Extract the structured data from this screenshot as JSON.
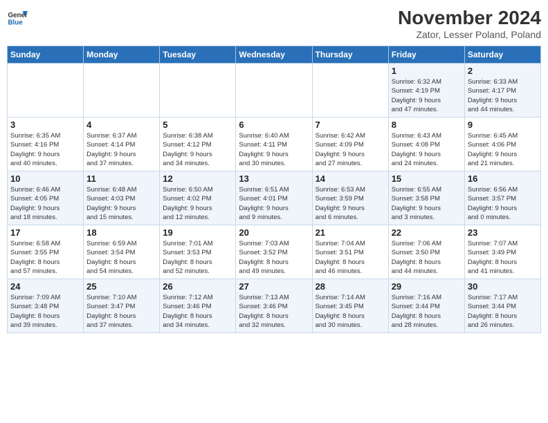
{
  "logo": {
    "line1": "General",
    "line2": "Blue"
  },
  "title": "November 2024",
  "location": "Zator, Lesser Poland, Poland",
  "headers": [
    "Sunday",
    "Monday",
    "Tuesday",
    "Wednesday",
    "Thursday",
    "Friday",
    "Saturday"
  ],
  "weeks": [
    [
      {
        "day": "",
        "info": ""
      },
      {
        "day": "",
        "info": ""
      },
      {
        "day": "",
        "info": ""
      },
      {
        "day": "",
        "info": ""
      },
      {
        "day": "",
        "info": ""
      },
      {
        "day": "1",
        "info": "Sunrise: 6:32 AM\nSunset: 4:19 PM\nDaylight: 9 hours\nand 47 minutes."
      },
      {
        "day": "2",
        "info": "Sunrise: 6:33 AM\nSunset: 4:17 PM\nDaylight: 9 hours\nand 44 minutes."
      }
    ],
    [
      {
        "day": "3",
        "info": "Sunrise: 6:35 AM\nSunset: 4:16 PM\nDaylight: 9 hours\nand 40 minutes."
      },
      {
        "day": "4",
        "info": "Sunrise: 6:37 AM\nSunset: 4:14 PM\nDaylight: 9 hours\nand 37 minutes."
      },
      {
        "day": "5",
        "info": "Sunrise: 6:38 AM\nSunset: 4:12 PM\nDaylight: 9 hours\nand 34 minutes."
      },
      {
        "day": "6",
        "info": "Sunrise: 6:40 AM\nSunset: 4:11 PM\nDaylight: 9 hours\nand 30 minutes."
      },
      {
        "day": "7",
        "info": "Sunrise: 6:42 AM\nSunset: 4:09 PM\nDaylight: 9 hours\nand 27 minutes."
      },
      {
        "day": "8",
        "info": "Sunrise: 6:43 AM\nSunset: 4:08 PM\nDaylight: 9 hours\nand 24 minutes."
      },
      {
        "day": "9",
        "info": "Sunrise: 6:45 AM\nSunset: 4:06 PM\nDaylight: 9 hours\nand 21 minutes."
      }
    ],
    [
      {
        "day": "10",
        "info": "Sunrise: 6:46 AM\nSunset: 4:05 PM\nDaylight: 9 hours\nand 18 minutes."
      },
      {
        "day": "11",
        "info": "Sunrise: 6:48 AM\nSunset: 4:03 PM\nDaylight: 9 hours\nand 15 minutes."
      },
      {
        "day": "12",
        "info": "Sunrise: 6:50 AM\nSunset: 4:02 PM\nDaylight: 9 hours\nand 12 minutes."
      },
      {
        "day": "13",
        "info": "Sunrise: 6:51 AM\nSunset: 4:01 PM\nDaylight: 9 hours\nand 9 minutes."
      },
      {
        "day": "14",
        "info": "Sunrise: 6:53 AM\nSunset: 3:59 PM\nDaylight: 9 hours\nand 6 minutes."
      },
      {
        "day": "15",
        "info": "Sunrise: 6:55 AM\nSunset: 3:58 PM\nDaylight: 9 hours\nand 3 minutes."
      },
      {
        "day": "16",
        "info": "Sunrise: 6:56 AM\nSunset: 3:57 PM\nDaylight: 9 hours\nand 0 minutes."
      }
    ],
    [
      {
        "day": "17",
        "info": "Sunrise: 6:58 AM\nSunset: 3:55 PM\nDaylight: 8 hours\nand 57 minutes."
      },
      {
        "day": "18",
        "info": "Sunrise: 6:59 AM\nSunset: 3:54 PM\nDaylight: 8 hours\nand 54 minutes."
      },
      {
        "day": "19",
        "info": "Sunrise: 7:01 AM\nSunset: 3:53 PM\nDaylight: 8 hours\nand 52 minutes."
      },
      {
        "day": "20",
        "info": "Sunrise: 7:03 AM\nSunset: 3:52 PM\nDaylight: 8 hours\nand 49 minutes."
      },
      {
        "day": "21",
        "info": "Sunrise: 7:04 AM\nSunset: 3:51 PM\nDaylight: 8 hours\nand 46 minutes."
      },
      {
        "day": "22",
        "info": "Sunrise: 7:06 AM\nSunset: 3:50 PM\nDaylight: 8 hours\nand 44 minutes."
      },
      {
        "day": "23",
        "info": "Sunrise: 7:07 AM\nSunset: 3:49 PM\nDaylight: 8 hours\nand 41 minutes."
      }
    ],
    [
      {
        "day": "24",
        "info": "Sunrise: 7:09 AM\nSunset: 3:48 PM\nDaylight: 8 hours\nand 39 minutes."
      },
      {
        "day": "25",
        "info": "Sunrise: 7:10 AM\nSunset: 3:47 PM\nDaylight: 8 hours\nand 37 minutes."
      },
      {
        "day": "26",
        "info": "Sunrise: 7:12 AM\nSunset: 3:46 PM\nDaylight: 8 hours\nand 34 minutes."
      },
      {
        "day": "27",
        "info": "Sunrise: 7:13 AM\nSunset: 3:46 PM\nDaylight: 8 hours\nand 32 minutes."
      },
      {
        "day": "28",
        "info": "Sunrise: 7:14 AM\nSunset: 3:45 PM\nDaylight: 8 hours\nand 30 minutes."
      },
      {
        "day": "29",
        "info": "Sunrise: 7:16 AM\nSunset: 3:44 PM\nDaylight: 8 hours\nand 28 minutes."
      },
      {
        "day": "30",
        "info": "Sunrise: 7:17 AM\nSunset: 3:44 PM\nDaylight: 8 hours\nand 26 minutes."
      }
    ]
  ]
}
